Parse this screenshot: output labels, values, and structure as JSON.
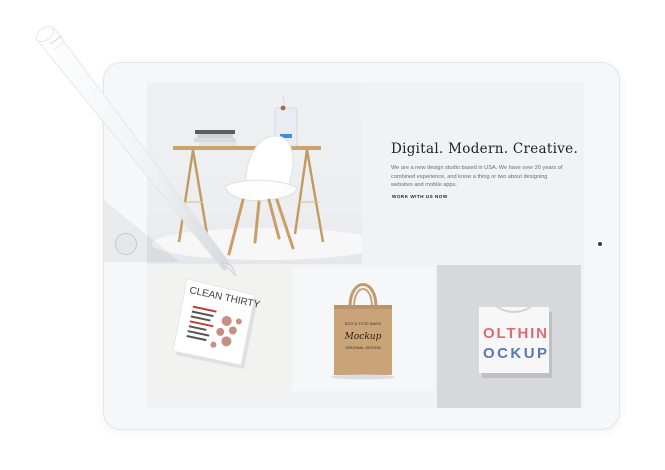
{
  "hero": {
    "headline": "Digital. Modern. Creative.",
    "description": "We are a new design studio based in USA. We have over 20 years of combined experience, and know a thing or two about designing websites and mobile apps.",
    "cta_label": "WORK WITH US NOW"
  },
  "products": {
    "magazine_cover_title": "CLEAN THIRTY",
    "bag_print_lines": [
      "ECO & TOTE BAGS",
      "Mockup",
      "ORIGINAL DESIGN"
    ],
    "shirt_print_lines": [
      "OLTHIN",
      "OCKUP"
    ]
  },
  "icons": {
    "pencil": "stylus-pencil-icon",
    "home_button": "home-button-icon",
    "camera": "camera-icon"
  },
  "colors": {
    "tablet_body": "#f6f7f9",
    "screen_bg": "#f1f2f4",
    "heading": "#222222",
    "text": "#6a6d72",
    "shirt_text_red": "#e06a73",
    "shirt_text_blue": "#5b78b0"
  }
}
